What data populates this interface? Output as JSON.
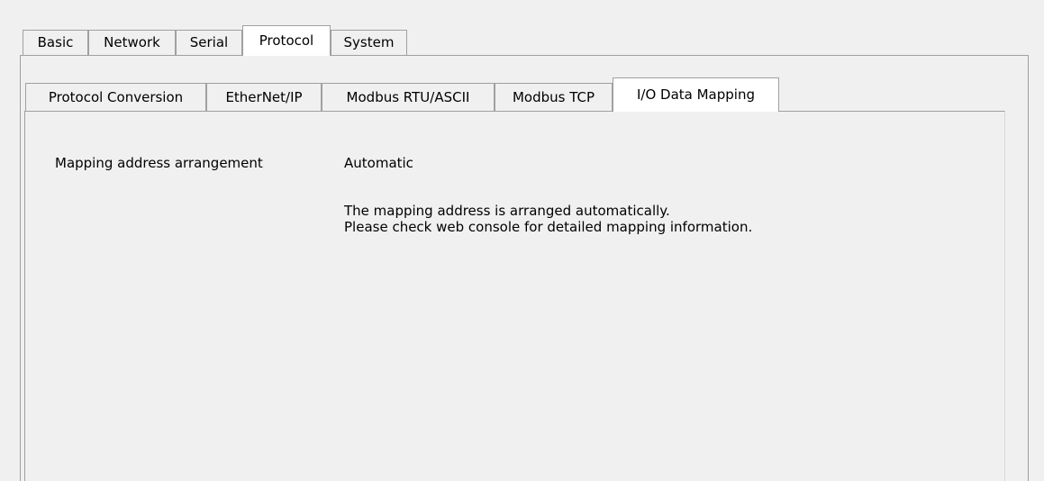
{
  "outer_tabs": [
    {
      "label": "Basic",
      "active": false
    },
    {
      "label": "Network",
      "active": false
    },
    {
      "label": "Serial",
      "active": false
    },
    {
      "label": "Protocol",
      "active": true
    },
    {
      "label": "System",
      "active": false
    }
  ],
  "inner_tabs": [
    {
      "label": "Protocol Conversion",
      "active": false
    },
    {
      "label": "EtherNet/IP",
      "active": false
    },
    {
      "label": "Modbus RTU/ASCII",
      "active": false
    },
    {
      "label": "Modbus TCP",
      "active": false
    },
    {
      "label": "I/O Data Mapping",
      "active": true
    }
  ],
  "mapping": {
    "label": "Mapping address arrangement",
    "value": "Automatic",
    "description_lines": [
      "The mapping address is arranged automatically.",
      "Please check web console for detailed mapping information."
    ]
  }
}
